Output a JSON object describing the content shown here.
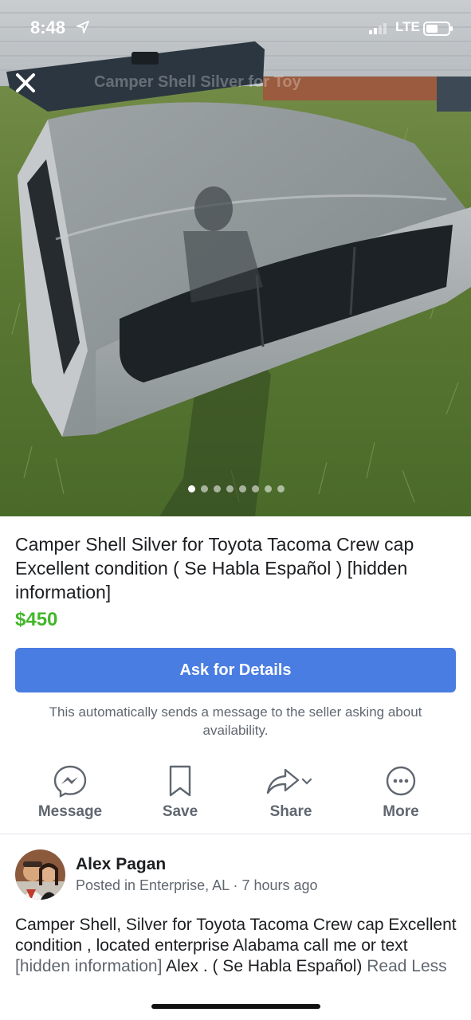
{
  "status_bar": {
    "time": "8:48",
    "network": "LTE"
  },
  "photo": {
    "caption_overlay": "Camper Shell Silver for Toy",
    "slide_count": 8,
    "active_slide": 1
  },
  "listing": {
    "title": "Camper Shell Silver for Toyota Tacoma Crew cap Excellent condition ( Se Habla Español ) [hidden information]",
    "price": "$450",
    "ask_button_label": "Ask for Details",
    "auto_note": "This automatically sends a message to the seller asking about availability."
  },
  "actions": {
    "message_label": "Message",
    "save_label": "Save",
    "share_label": "Share",
    "more_label": "More"
  },
  "seller": {
    "name": "Alex Pagan",
    "posted": "Posted in Enterprise, AL · 7 hours ago"
  },
  "description": {
    "text_part1": "Camper Shell, Silver for Toyota Tacoma Crew cap Excellent condition , located enterprise Alabama call me or text ",
    "hidden": "[hidden information]",
    "text_part2": " Alex . ( Se Habla Español) ",
    "read_less": "Read Less"
  },
  "colors": {
    "accent_button": "#4a7de2",
    "price": "#42b72a",
    "secondary_text": "#606770"
  }
}
